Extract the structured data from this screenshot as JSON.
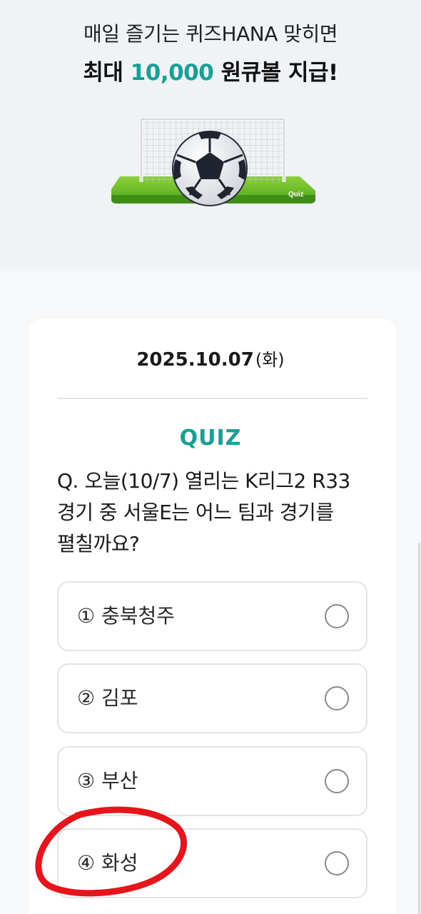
{
  "banner": {
    "line1": "매일 즐기는 퀴즈HANA 맞히면",
    "line2_prefix": "최대 ",
    "line2_amount": "10,000",
    "line2_suffix": " 원큐볼 지급!",
    "accent_color": "#16a096",
    "illustration_icon": "soccer-goal-ball-icon",
    "illustration_text": "Quiz"
  },
  "quiz": {
    "date": "2025.10.07",
    "day_of_week": "(화)",
    "title": "QUIZ",
    "question": "Q. 오늘(10/7) 열리는 K리그2 R33 경기 중 서울E는 어느 팀과 경기를 펼칠까요?",
    "options": [
      {
        "label": "① 충북청주"
      },
      {
        "label": "② 김포"
      },
      {
        "label": "③ 부산"
      },
      {
        "label": "④ 화성"
      }
    ]
  },
  "annotation": {
    "type": "hand-drawn red circle",
    "target": "option 4",
    "color": "#e8141c"
  }
}
